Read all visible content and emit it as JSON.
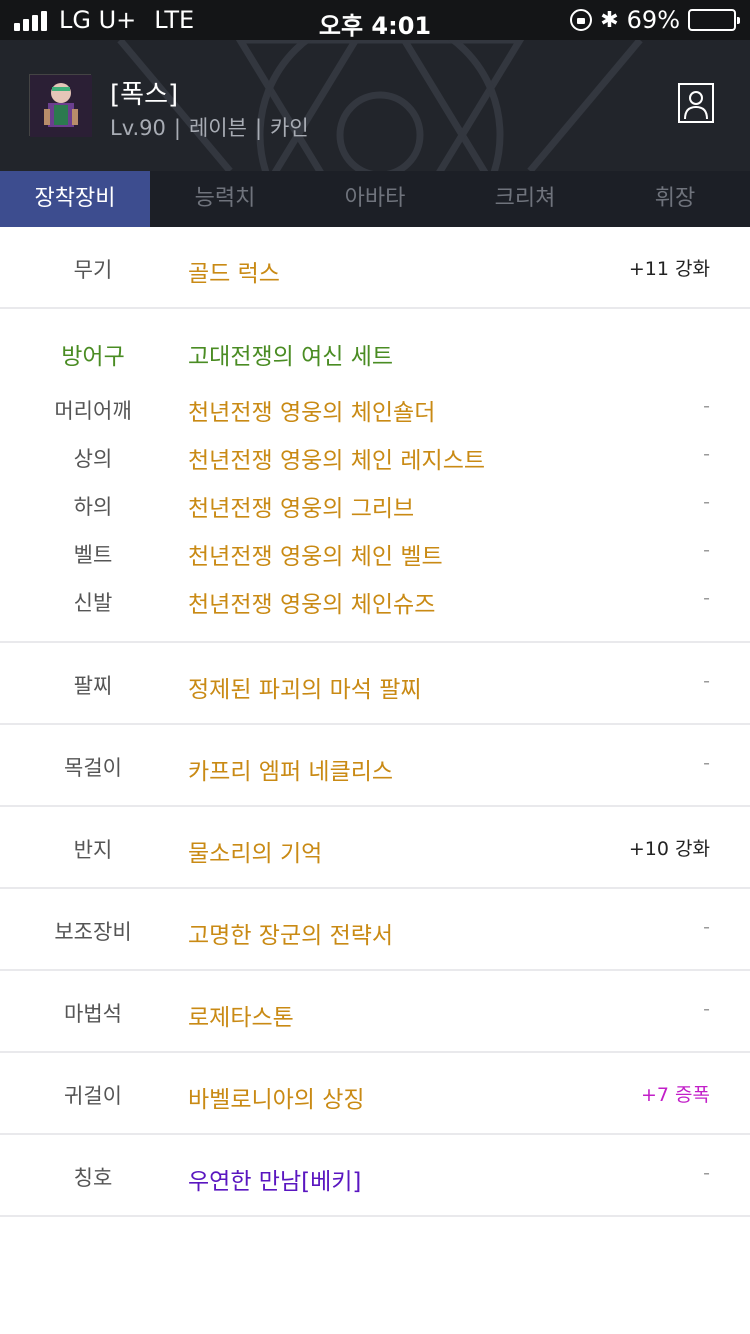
{
  "status_bar": {
    "carrier": "LG U+",
    "network": "LTE",
    "time": "오후 4:01",
    "battery": "69%",
    "battery_level": 0.69
  },
  "character": {
    "name": "[폭스]",
    "level": "Lv.90",
    "job": "레이븐",
    "server": "카인",
    "separator": "|"
  },
  "tabs": [
    {
      "label": "장착장비",
      "active": true
    },
    {
      "label": "능력치",
      "active": false
    },
    {
      "label": "아바타",
      "active": false
    },
    {
      "label": "크리쳐",
      "active": false
    },
    {
      "label": "휘장",
      "active": false
    }
  ],
  "weapon": {
    "slot": "무기",
    "item": "골드 럭스",
    "extra": "+11 강화"
  },
  "armor": {
    "slot": "방어구",
    "set_name": "고대전쟁의 여신 세트",
    "pieces": [
      {
        "slot": "머리어깨",
        "item": "천년전쟁 영웅의 체인숄더",
        "extra": "-"
      },
      {
        "slot": "상의",
        "item": "천년전쟁 영웅의 체인 레지스트",
        "extra": "-"
      },
      {
        "slot": "하의",
        "item": "천년전쟁 영웅의 그리브",
        "extra": "-"
      },
      {
        "slot": "벨트",
        "item": "천년전쟁 영웅의 체인 벨트",
        "extra": "-"
      },
      {
        "slot": "신발",
        "item": "천년전쟁 영웅의 체인슈즈",
        "extra": "-"
      }
    ]
  },
  "accessories": [
    {
      "slot": "팔찌",
      "item": "정제된 파괴의 마석 팔찌",
      "extra": "-"
    },
    {
      "slot": "목걸이",
      "item": "카프리 엠퍼 네클리스",
      "extra": "-"
    },
    {
      "slot": "반지",
      "item": "물소리의 기억",
      "extra": "+10 강화"
    },
    {
      "slot": "보조장비",
      "item": "고명한 장군의 전략서",
      "extra": "-"
    },
    {
      "slot": "마법석",
      "item": "로제타스톤",
      "extra": "-"
    },
    {
      "slot": "귀걸이",
      "item": "바벨로니아의 상징",
      "extra": "+7 증폭"
    },
    {
      "slot": "칭호",
      "item": "우연한 만남[베키]",
      "extra": "-"
    }
  ],
  "colors": {
    "item_gold": "#c98a14",
    "set_green": "#4a8c23",
    "title_purple": "#5a16c0",
    "amplify_magenta": "#c21fc8",
    "tab_active": "#3d4d8f"
  }
}
